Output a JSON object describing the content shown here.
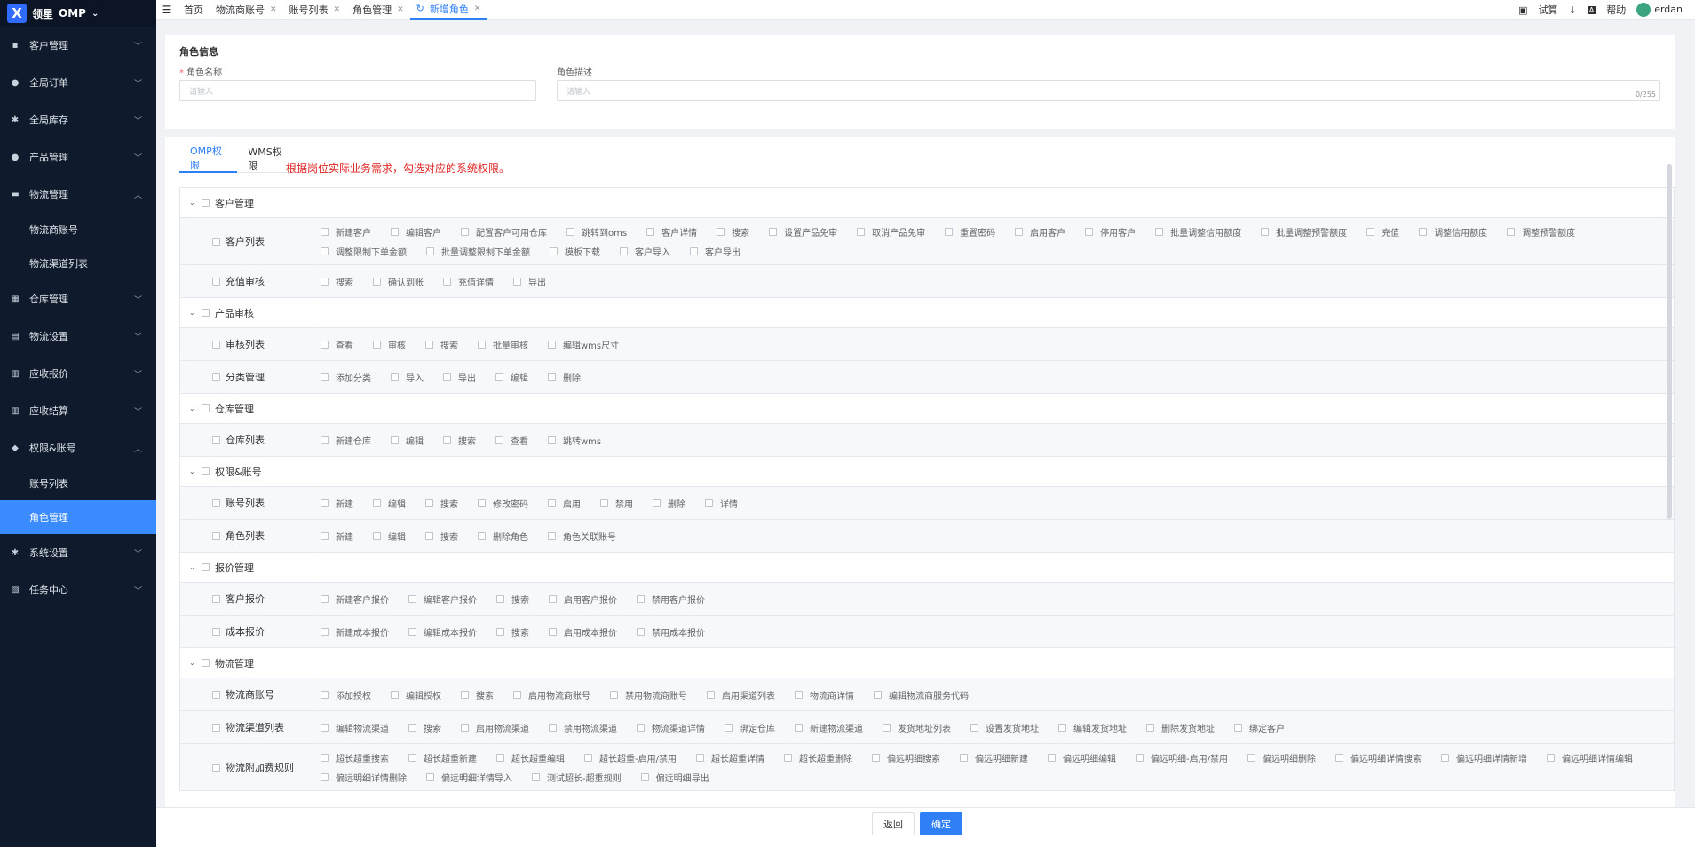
{
  "brand": {
    "logo": "X",
    "name": "领星",
    "product": "OMP"
  },
  "sidebar": {
    "items": [
      {
        "label": "客户管理",
        "icon": "briefcase-icon",
        "expanded": false
      },
      {
        "label": "全局订单",
        "icon": "user-icon",
        "expanded": false
      },
      {
        "label": "全局库存",
        "icon": "gear-icon",
        "expanded": false
      },
      {
        "label": "产品管理",
        "icon": "user-icon",
        "expanded": false
      },
      {
        "label": "物流管理",
        "icon": "truck-icon",
        "expanded": true,
        "children": [
          "物流商账号",
          "物流渠道列表"
        ]
      },
      {
        "label": "仓库管理",
        "icon": "warehouse-icon",
        "expanded": false
      },
      {
        "label": "物流设置",
        "icon": "settings-icon",
        "expanded": false
      },
      {
        "label": "应收报价",
        "icon": "document-icon",
        "expanded": false
      },
      {
        "label": "应收结算",
        "icon": "document-icon",
        "expanded": false
      },
      {
        "label": "权限&账号",
        "icon": "shield-icon",
        "expanded": true,
        "children": [
          "账号列表",
          "角色管理"
        ]
      },
      {
        "label": "系统设置",
        "icon": "gear-icon",
        "expanded": false
      },
      {
        "label": "任务中心",
        "icon": "clipboard-icon",
        "expanded": false
      }
    ],
    "active_child": "角色管理"
  },
  "tabs": [
    {
      "label": "首页",
      "closable": false
    },
    {
      "label": "物流商账号",
      "closable": true
    },
    {
      "label": "账号列表",
      "closable": true
    },
    {
      "label": "角色管理",
      "closable": true
    },
    {
      "label": "新增角色",
      "closable": true,
      "active": true
    }
  ],
  "top_right": {
    "trial": "试算",
    "help": "帮助",
    "user": "erdan"
  },
  "form": {
    "title": "角色信息",
    "name_label": "角色名称",
    "name_placeholder": "请输入",
    "desc_label": "角色描述",
    "desc_placeholder": "请输入",
    "desc_count": "0/255"
  },
  "perm_tabs": [
    "OMP权限",
    "WMS权限"
  ],
  "hint": "根据岗位实际业务需求，勾选对应的系统权限。",
  "permissions": [
    {
      "group": "客户管理",
      "subs": [
        {
          "name": "客户列表",
          "perms": [
            "新建客户",
            "编辑客户",
            "配置客户可用仓库",
            "跳转到oms",
            "客户详情",
            "搜索",
            "设置产品免审",
            "取消产品免审",
            "重置密码",
            "启用客户",
            "停用客户",
            "批量调整信用额度",
            "批量调整预警额度",
            "充值",
            "调整信用额度",
            "调整预警额度",
            "调整限制下单金额",
            "批量调整限制下单金额",
            "模板下载",
            "客户导入",
            "客户导出"
          ]
        },
        {
          "name": "充值审核",
          "perms": [
            "搜索",
            "确认到账",
            "充值详情",
            "导出"
          ]
        }
      ]
    },
    {
      "group": "产品审核",
      "subs": [
        {
          "name": "审核列表",
          "perms": [
            "查看",
            "审核",
            "搜索",
            "批量审核",
            "编辑wms尺寸"
          ]
        },
        {
          "name": "分类管理",
          "perms": [
            "添加分类",
            "导入",
            "导出",
            "编辑",
            "删除"
          ]
        }
      ]
    },
    {
      "group": "仓库管理",
      "subs": [
        {
          "name": "仓库列表",
          "perms": [
            "新建仓库",
            "编辑",
            "搜索",
            "查看",
            "跳转wms"
          ]
        }
      ]
    },
    {
      "group": "权限&账号",
      "subs": [
        {
          "name": "账号列表",
          "perms": [
            "新建",
            "编辑",
            "搜索",
            "修改密码",
            "启用",
            "禁用",
            "删除",
            "详情"
          ]
        },
        {
          "name": "角色列表",
          "perms": [
            "新建",
            "编辑",
            "搜索",
            "删除角色",
            "角色关联账号"
          ]
        }
      ]
    },
    {
      "group": "报价管理",
      "subs": [
        {
          "name": "客户报价",
          "perms": [
            "新建客户报价",
            "编辑客户报价",
            "搜索",
            "启用客户报价",
            "禁用客户报价"
          ]
        },
        {
          "name": "成本报价",
          "perms": [
            "新建成本报价",
            "编辑成本报价",
            "搜索",
            "启用成本报价",
            "禁用成本报价"
          ]
        }
      ]
    },
    {
      "group": "物流管理",
      "subs": [
        {
          "name": "物流商账号",
          "perms": [
            "添加授权",
            "编辑授权",
            "搜索",
            "启用物流商账号",
            "禁用物流商账号",
            "启用渠道列表",
            "物流商详情",
            "编辑物流商服务代码"
          ]
        },
        {
          "name": "物流渠道列表",
          "perms": [
            "编辑物流渠道",
            "搜索",
            "启用物流渠道",
            "禁用物流渠道",
            "物流渠道详情",
            "绑定仓库",
            "新建物流渠道",
            "发货地址列表",
            "设置发货地址",
            "编辑发货地址",
            "删除发货地址",
            "绑定客户"
          ]
        },
        {
          "name": "物流附加费规则",
          "perms": [
            "超长超重搜索",
            "超长超重新建",
            "超长超重编辑",
            "超长超重-启用/禁用",
            "超长超重详情",
            "超长超重删除",
            "偏远明细搜索",
            "偏远明细新建",
            "偏远明细编辑",
            "偏远明细-启用/禁用",
            "偏远明细删除",
            "偏远明细详情搜索",
            "偏远明细详情新增",
            "偏远明细详情编辑",
            "偏远明细详情删除",
            "偏远明细详情导入",
            "测试超长-超重规则",
            "偏远明细导出"
          ]
        }
      ]
    }
  ],
  "footer": {
    "back": "返回",
    "confirm": "确定"
  },
  "colors": {
    "sidebar_bg": "#0f1b2d",
    "accent": "#2f7ff7",
    "hint": "#e02424",
    "active_menu": "#3a8bff"
  }
}
